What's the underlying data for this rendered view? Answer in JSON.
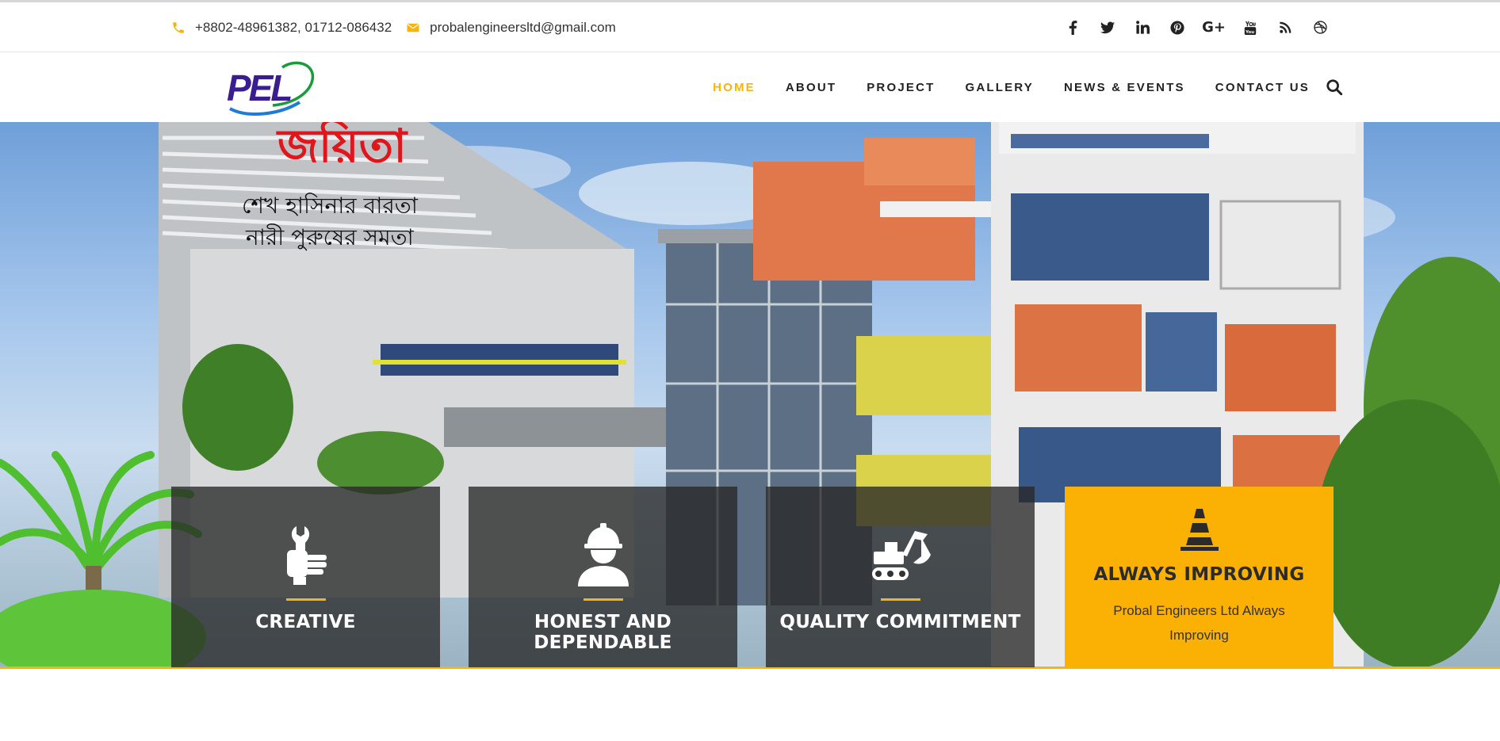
{
  "topbar": {
    "phone": "+8802-48961382, 01712-086432",
    "email": "probalengineersltd@gmail.com",
    "social": [
      "facebook-icon",
      "twitter-icon",
      "linkedin-icon",
      "pinterest-icon",
      "google-plus-icon",
      "youtube-icon",
      "rss-icon",
      "dribbble-icon"
    ]
  },
  "logo": {
    "text": "PEL"
  },
  "nav": {
    "items": [
      {
        "label": "HOME",
        "active": true
      },
      {
        "label": "ABOUT"
      },
      {
        "label": "PROJECT"
      },
      {
        "label": "GALLERY"
      },
      {
        "label": "NEWS & EVENTS"
      },
      {
        "label": "CONTACT US"
      }
    ]
  },
  "features": [
    {
      "title": "CREATIVE",
      "icon": "wrench-hand-icon"
    },
    {
      "title": "HONEST AND DEPENDABLE",
      "icon": "worker-helmet-icon"
    },
    {
      "title": "QUALITY COMMITMENT",
      "icon": "excavator-icon"
    },
    {
      "title": "ALWAYS IMPROVING",
      "icon": "traffic-cone-icon",
      "desc": "Probal Engineers Ltd Always Improving"
    }
  ],
  "colors": {
    "accent": "#f5b50a",
    "highlight_box": "#fbb104",
    "text_dark": "#222222"
  }
}
